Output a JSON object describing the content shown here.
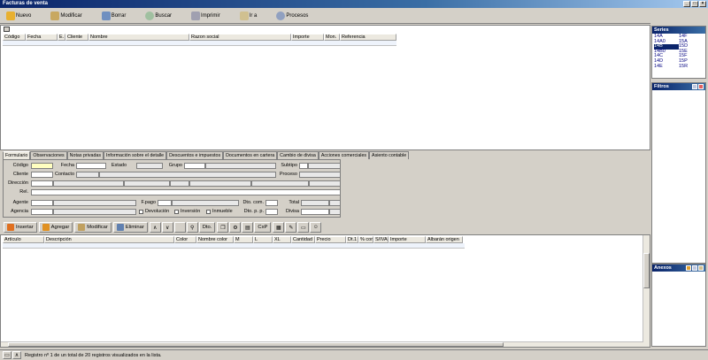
{
  "window": {
    "title": "Facturas de venta"
  },
  "toolbar": [
    "Nuevo",
    "Modificar",
    "Borrar",
    "Buscar",
    "Imprimir",
    "Ir a",
    "Procesos"
  ],
  "main_grid": {
    "columns": [
      "Código",
      "Fecha",
      "E.",
      "Cliente",
      "Nombre",
      "Razon social",
      "Importe",
      "Mon.",
      "Referencia"
    ]
  },
  "series": {
    "title": "Series",
    "items": [
      "14A",
      "14F",
      "14A0",
      "15A",
      "14B",
      "15D",
      "14B0",
      "15E",
      "14C",
      "15F",
      "14D",
      "15P",
      "14E",
      "15R"
    ],
    "selected": "14B"
  },
  "filtros": {
    "title": "Filtros"
  },
  "anexos": {
    "title": "Anexos"
  },
  "tabs": [
    "Formulario",
    "Observaciones",
    "Notas privadas",
    "Información sobre el detalle",
    "Descuentos e impuestos",
    "Documentos en cartera",
    "Cambio de divisa",
    "Acciones comerciales",
    "Asiento contable"
  ],
  "form": {
    "codigo": "Código",
    "fecha": "Fecha",
    "estado": "Estado",
    "grupo": "Grupo",
    "subtipo": "Subtipo",
    "cliente": "Cliente",
    "contacto": "Contacto",
    "proceso": "Proceso",
    "direccion": "Dirección",
    "rel": "Rel.",
    "agente": "Agente",
    "fpago": "F.pago",
    "dto_com": "Dto. com.",
    "total": "Total",
    "agencia": "Agencia",
    "devolucion": "Devolución",
    "inversion": "Inversión",
    "inmueble": "Inmueble",
    "dto_pp": "Dto. p. p.",
    "divisa": "Divisa"
  },
  "detail_toolbar": {
    "insertar": "Insertar",
    "agregar": "Agregar",
    "modificar": "Modificar",
    "eliminar": "Eliminar",
    "dto": "Dto.",
    "cxp": "CxP"
  },
  "detail_grid": {
    "columns": [
      "Artículo",
      "Descripción",
      "Color",
      "Nombre color",
      "M",
      "L",
      "XL",
      "Cantidad",
      "Precio",
      "Dt.1",
      "% com",
      "S/IVA",
      "Importe",
      "Albarán origen"
    ]
  },
  "status": "Registro nº 1 de un total de 20 registros visualizados en la lista."
}
